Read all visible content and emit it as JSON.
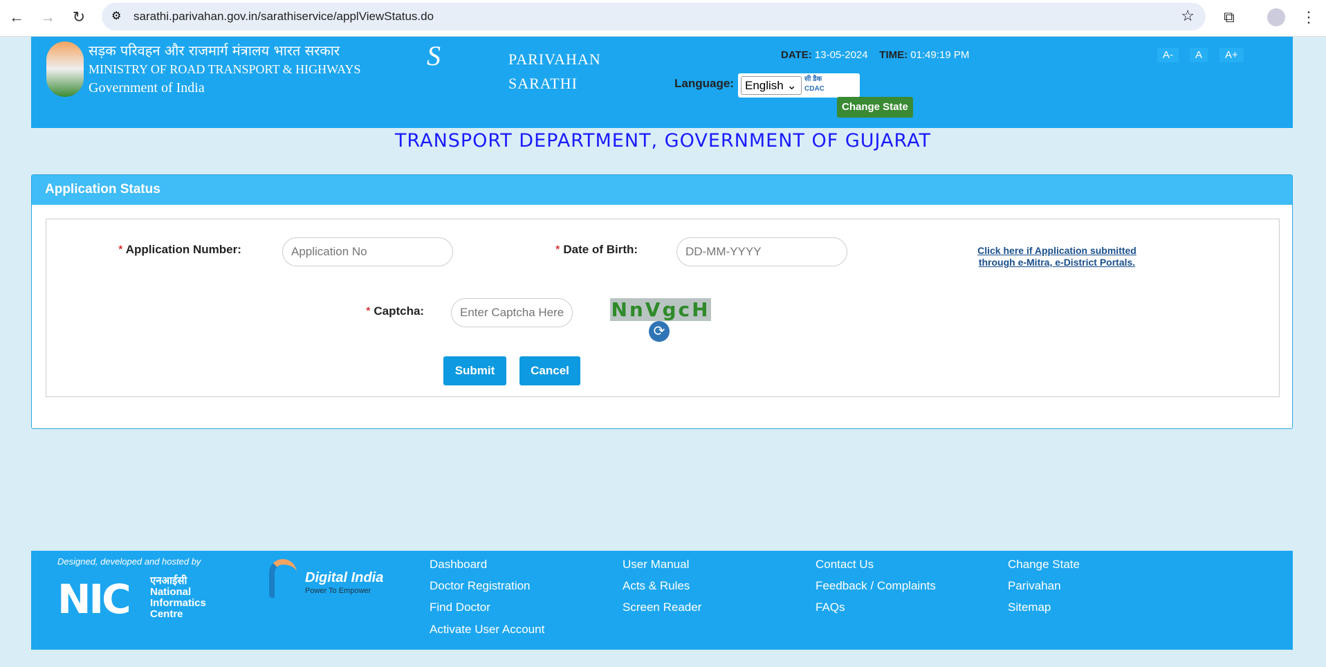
{
  "browser": {
    "url": "sarathi.parivahan.gov.in/sarathiservice/applViewStatus.do"
  },
  "header": {
    "ministry_hindi": "सड़क परिवहन और राजमार्ग मंत्रालय भारत सरकार",
    "ministry": "MINISTRY OF ROAD TRANSPORT & HIGHWAYS",
    "gov": "Government of India",
    "brand1": "PARIVAHAN",
    "brand2": "SARATHI",
    "date_label": "DATE:",
    "date": "13-05-2024",
    "time_label": "TIME:",
    "time": "01:49:19 PM",
    "font_small": "A-",
    "font_normal": "A",
    "font_large": "A+",
    "language_label": "Language:",
    "language": "English",
    "cdac": "सी डैक CDAC",
    "change_state": "Change State"
  },
  "page_title": "TRANSPORT DEPARTMENT, GOVERNMENT OF GUJARAT",
  "panel": {
    "title": "Application Status",
    "app_label": "Application Number:",
    "app_placeholder": "Application No",
    "dob_label": "Date of Birth:",
    "dob_placeholder": "DD-MM-YYYY",
    "link1": "Click here if Application submitted",
    "link2": "through e-Mitra, e-District Portals.",
    "captcha_label": "Captcha:",
    "captcha_placeholder": "Enter Captcha Here",
    "captcha_text": "NnVgcH",
    "submit": "Submit",
    "cancel": "Cancel",
    "required": "*"
  },
  "footer": {
    "designed": "Designed, developed and hosted by",
    "nic_hindi": "एनआईसी",
    "nic1": "National",
    "nic2": "Informatics",
    "nic3": "Centre",
    "di": "Digital India",
    "di_tag": "Power To Empower",
    "cols": [
      [
        "Dashboard",
        "Doctor Registration",
        "Find Doctor",
        "Activate User Account"
      ],
      [
        "User Manual",
        "Acts & Rules",
        "Screen Reader"
      ],
      [
        "Contact Us",
        "Feedback / Complaints",
        "FAQs"
      ],
      [
        "Change State",
        "Parivahan",
        "Sitemap"
      ]
    ]
  },
  "colors": {
    "header": "#1ca6ef",
    "panel_header": "#40bcf6",
    "button": "#0d9ae0",
    "change_state": "#3a8a34",
    "title": "#1a1aff"
  }
}
